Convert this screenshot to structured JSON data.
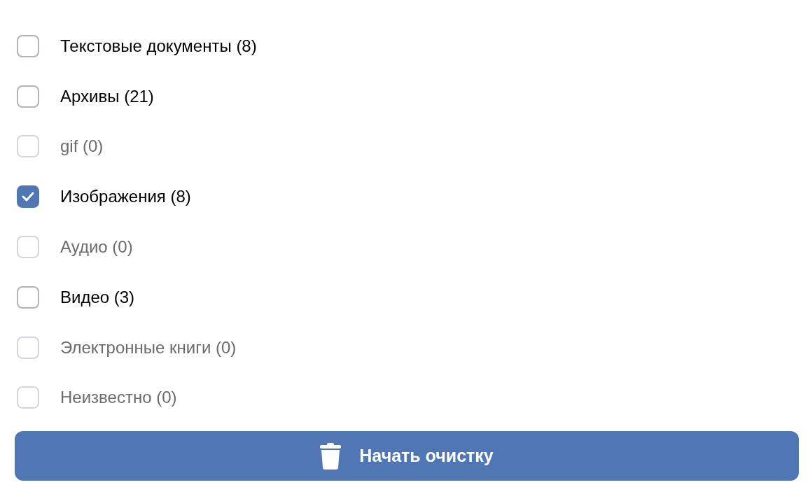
{
  "categories": [
    {
      "label": "Текстовые документы (8)",
      "checked": false,
      "disabled": false
    },
    {
      "label": "Архивы (21)",
      "checked": false,
      "disabled": false
    },
    {
      "label": "gif (0)",
      "checked": false,
      "disabled": true
    },
    {
      "label": "Изображения (8)",
      "checked": true,
      "disabled": false
    },
    {
      "label": "Аудио (0)",
      "checked": false,
      "disabled": true
    },
    {
      "label": "Видео (3)",
      "checked": false,
      "disabled": false
    },
    {
      "label": "Электронные книги (0)",
      "checked": false,
      "disabled": true
    },
    {
      "label": "Неизвестно (0)",
      "checked": false,
      "disabled": true
    }
  ],
  "button": {
    "label": "Начать очистку"
  }
}
